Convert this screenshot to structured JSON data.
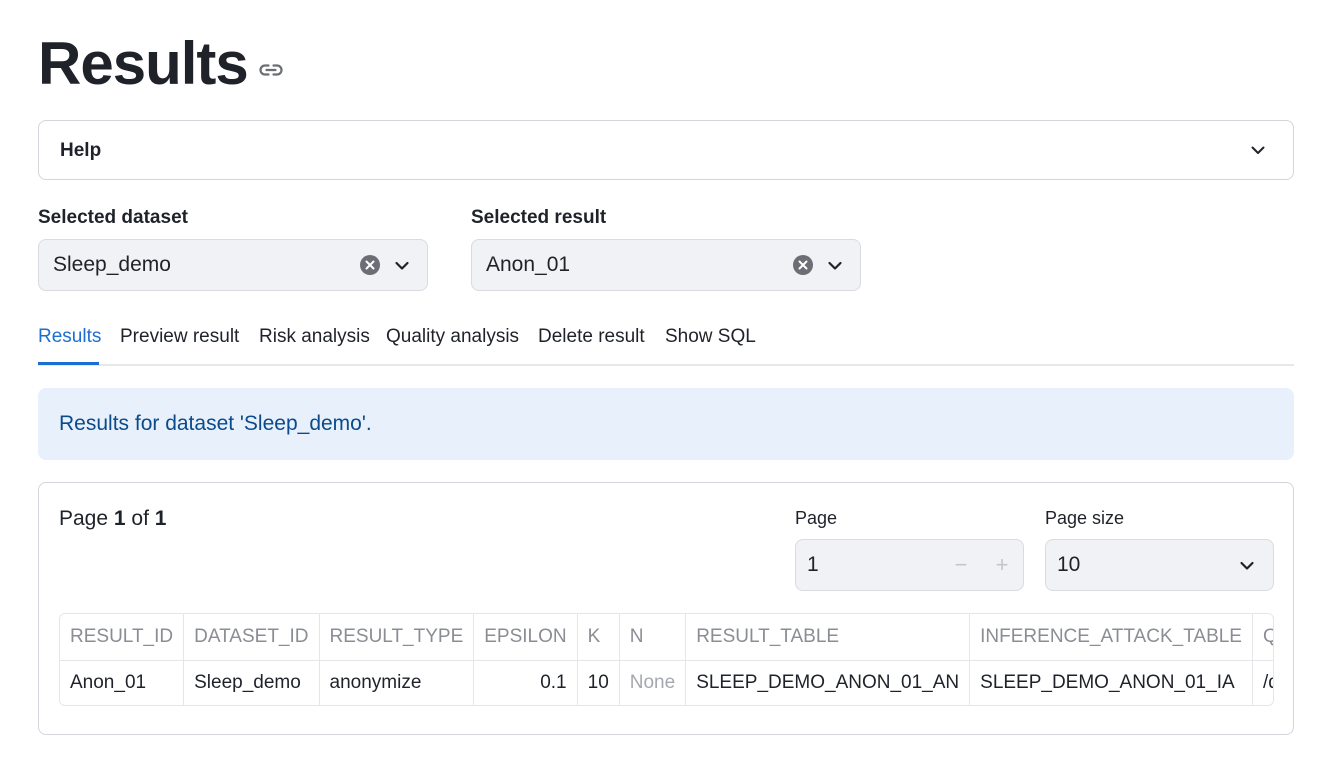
{
  "page": {
    "title": "Results"
  },
  "help": {
    "label": "Help"
  },
  "dataset_select": {
    "label": "Selected dataset",
    "value": "Sleep_demo"
  },
  "result_select": {
    "label": "Selected result",
    "value": "Anon_01"
  },
  "tabs": [
    {
      "label": "Results",
      "active": true
    },
    {
      "label": "Preview result",
      "active": false
    },
    {
      "label": "Risk analysis",
      "active": false
    },
    {
      "label": "Quality analysis",
      "active": false
    },
    {
      "label": "Delete result",
      "active": false
    },
    {
      "label": "Show SQL",
      "active": false
    }
  ],
  "info": {
    "message": "Results for dataset 'Sleep_demo'."
  },
  "pagination": {
    "prefix": "Page",
    "current": "1",
    "of_text": "of",
    "total": "1",
    "page_label": "Page",
    "page_value": "1",
    "minus": "−",
    "plus": "+",
    "page_size_label": "Page size",
    "page_size_value": "10"
  },
  "table": {
    "columns": [
      "RESULT_ID",
      "DATASET_ID",
      "RESULT_TYPE",
      "EPSILON",
      "K",
      "N",
      "RESULT_TABLE",
      "INFERENCE_ATTACK_TABLE",
      "QUALITY"
    ],
    "rows": [
      [
        "Anon_01",
        "Sleep_demo",
        "anonymize",
        "0.1",
        "10",
        "None",
        "SLEEP_DEMO_ANON_01_AN",
        "SLEEP_DEMO_ANON_01_IA",
        "/dataset"
      ]
    ]
  },
  "colors": {
    "accent": "#1c6fd1",
    "info_bg": "#e8f1fb",
    "info_text": "#0b4a8b",
    "input_bg": "#f0f2f6"
  }
}
